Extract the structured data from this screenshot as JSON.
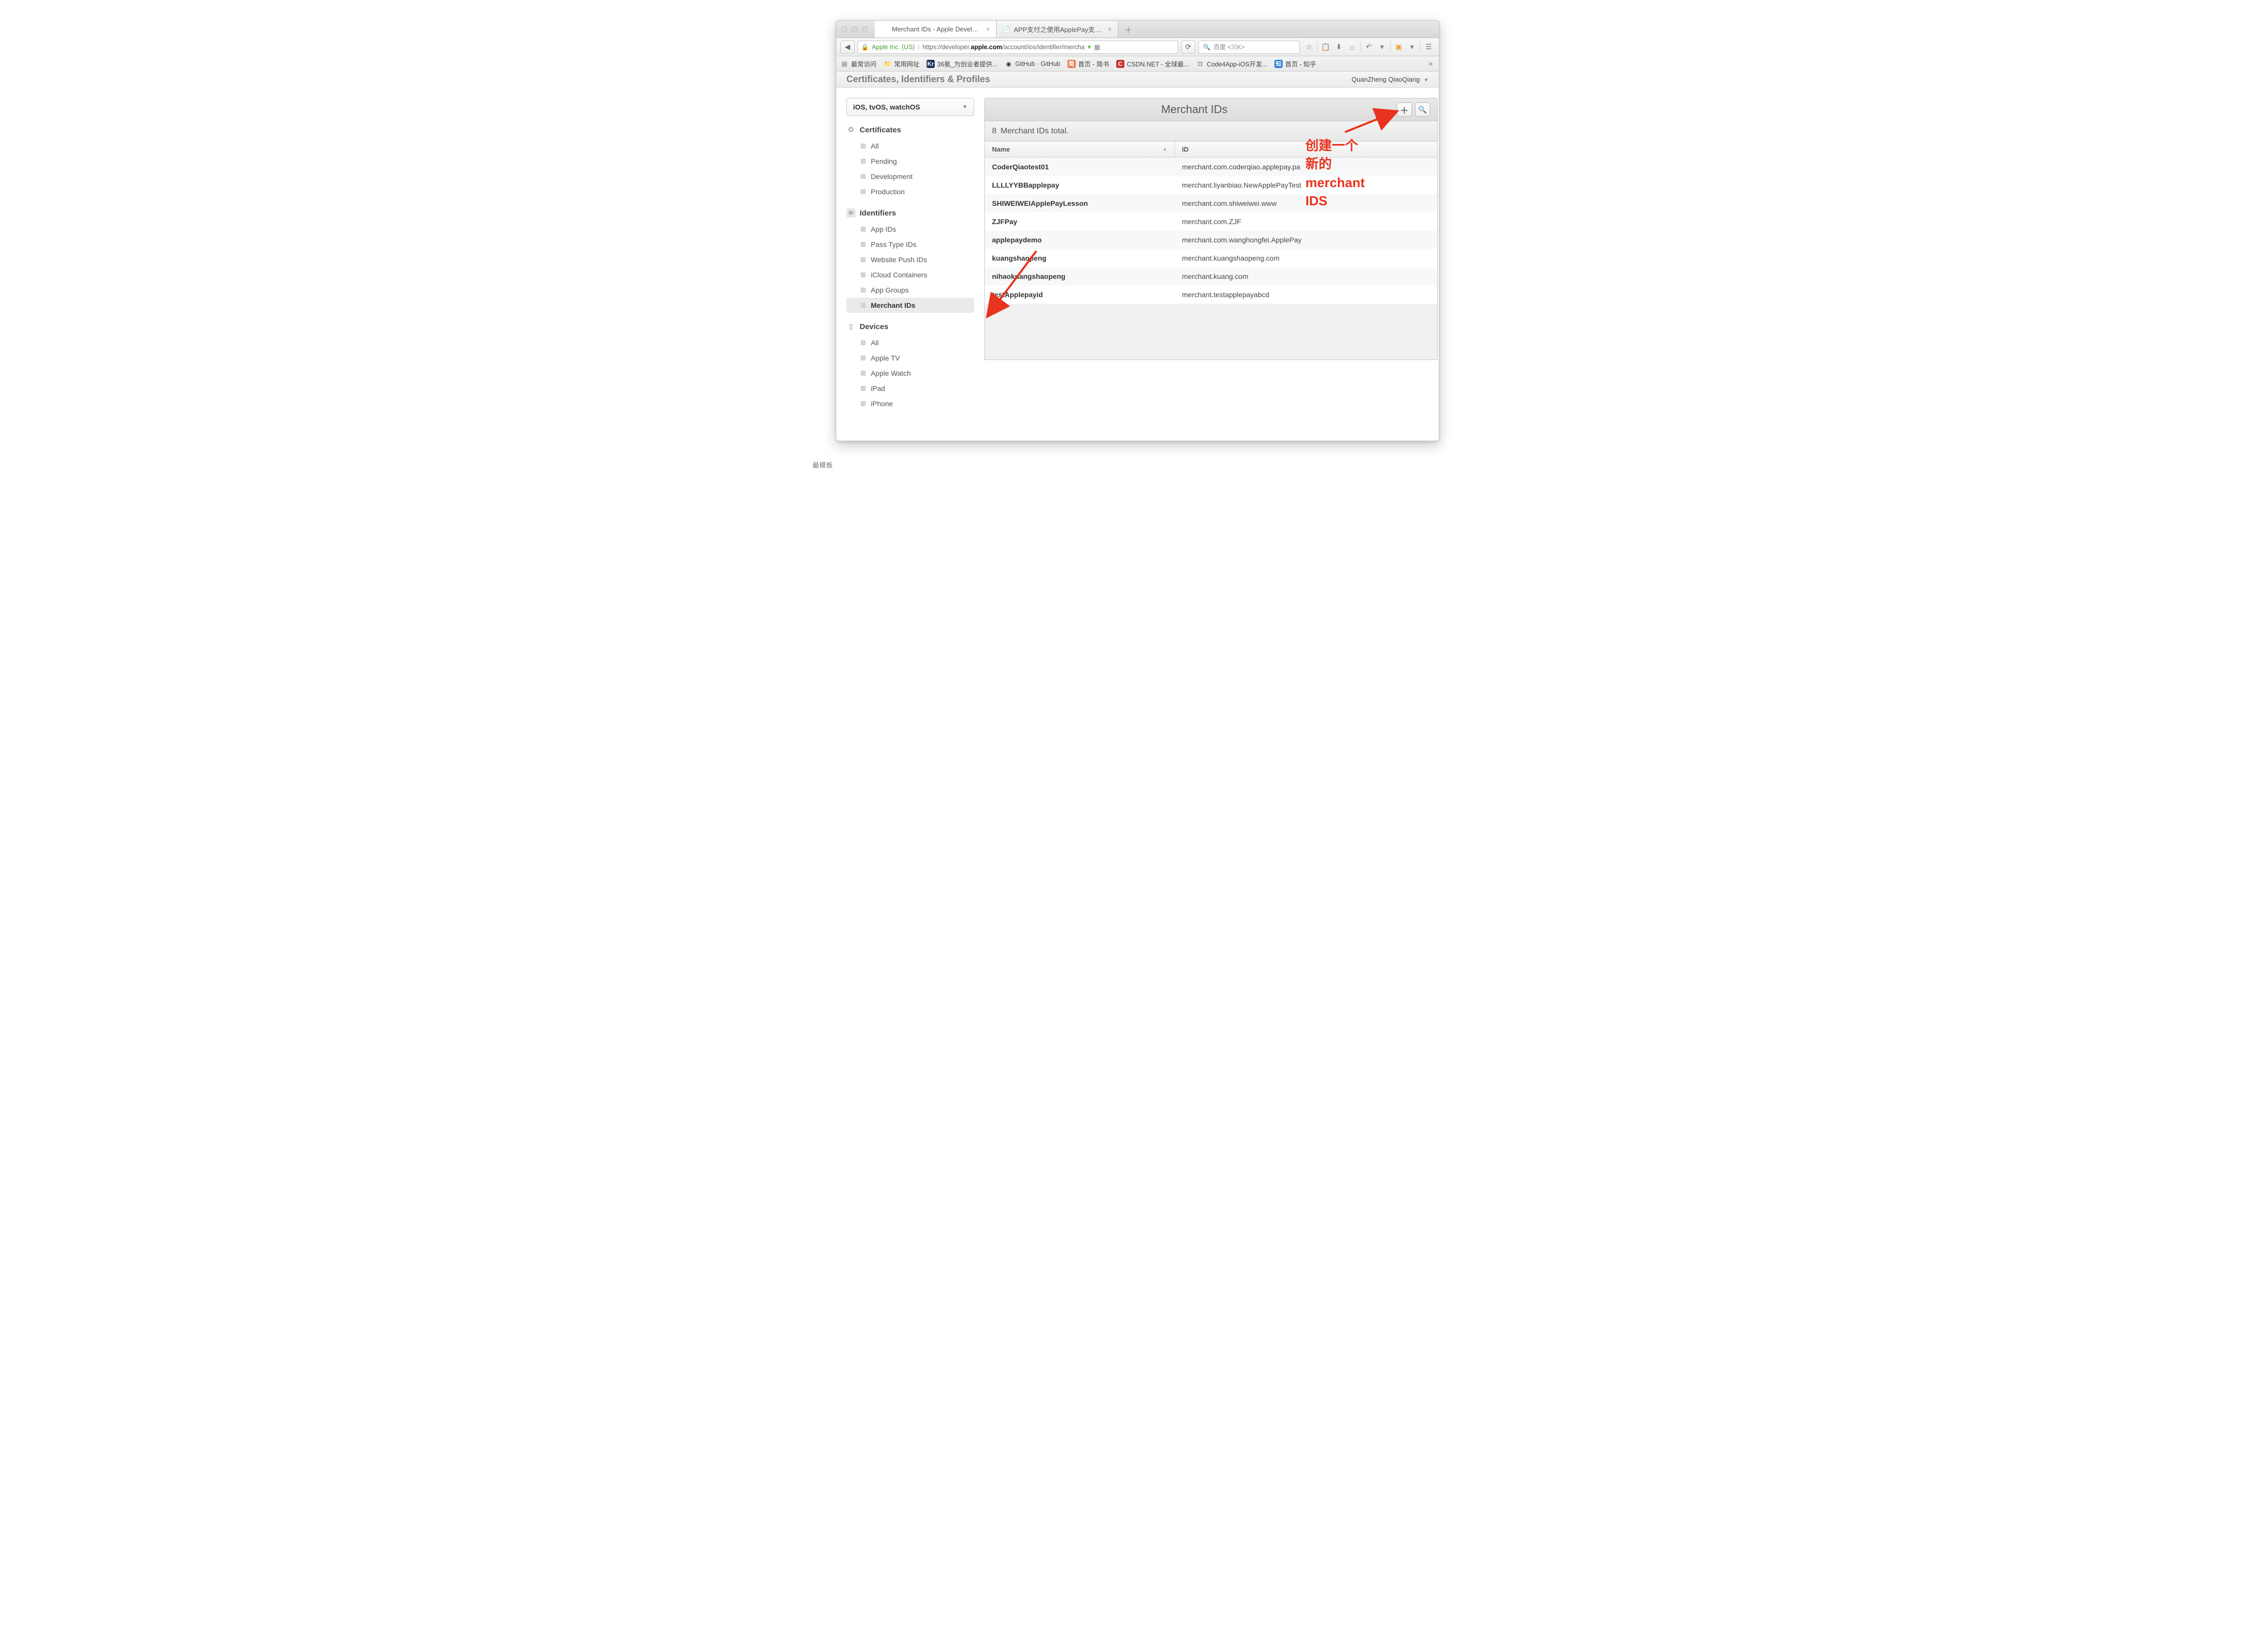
{
  "browser": {
    "tabs": [
      {
        "label": "Merchant IDs - Apple Developer",
        "active": true
      },
      {
        "label": "APP支付之使用ApplePay支付开发...",
        "active": false
      }
    ],
    "org": "Apple Inc. (US)",
    "url_prefix": "https://developer.",
    "url_host": "apple.com",
    "url_path": "/account/ios/identifier/mercha",
    "search_placeholder": "百度 <⌘K>",
    "bookmarks": [
      {
        "label": "最常访问",
        "iconClass": "bi-g"
      },
      {
        "label": "常用网址",
        "iconClass": "bi-g"
      },
      {
        "label": "36氪_为创业者提供...",
        "iconClass": "bi-k",
        "iconText": "Kr"
      },
      {
        "label": "GitHub · GitHub",
        "iconClass": "bi-gh",
        "iconText": "◉"
      },
      {
        "label": "首页 - 简书",
        "iconClass": "bi-or",
        "iconText": "简"
      },
      {
        "label": "CSDN.NET - 全球最...",
        "iconClass": "bi-rd",
        "iconText": "C"
      },
      {
        "label": "Code4App-iOS开发...",
        "iconClass": "bi-g",
        "iconText": "⊡"
      },
      {
        "label": "首页 - 知乎",
        "iconClass": "bi-bl",
        "iconText": "知"
      }
    ]
  },
  "page": {
    "breadcrumb": "Certificates, Identifiers & Profiles",
    "user": "QuanZheng QiaoQiang",
    "platform": "iOS, tvOS, watchOS",
    "panel_title": "Merchant IDs",
    "summary_count": "8",
    "summary_text": "Merchant IDs total.",
    "columns": {
      "name": "Name",
      "id": "ID"
    },
    "rows": [
      {
        "name": "CoderQiaotest01",
        "id": "merchant.com.coderqiao.applepay.pa"
      },
      {
        "name": "LLLLYYBBapplepay",
        "id": "merchant.liyanbiao.NewApplePayTest"
      },
      {
        "name": "SHIWEIWEIApplePayLesson",
        "id": "merchant.com.shiweiwei.www"
      },
      {
        "name": "ZJFPay",
        "id": "merchant.com.ZJF"
      },
      {
        "name": "applepaydemo",
        "id": "merchant.com.wanghongfei.ApplePay"
      },
      {
        "name": "kuangshaopeng",
        "id": "merchant.kuangshaopeng.com"
      },
      {
        "name": "nihaokuangshaopeng",
        "id": "merchant.kuang.com"
      },
      {
        "name": "testApplepayid",
        "id": "merchant.testapplepayabcd"
      }
    ],
    "nav": {
      "certificates": {
        "title": "Certificates",
        "items": [
          "All",
          "Pending",
          "Development",
          "Production"
        ]
      },
      "identifiers": {
        "title": "Identifiers",
        "items": [
          "App IDs",
          "Pass Type IDs",
          "Website Push IDs",
          "iCloud Containers",
          "App Groups",
          "Merchant IDs"
        ],
        "selected": "Merchant IDs"
      },
      "devices": {
        "title": "Devices",
        "items": [
          "All",
          "Apple TV",
          "Apple Watch",
          "iPad",
          "iPhone"
        ]
      }
    }
  },
  "annotations": {
    "line1": "创建一个",
    "line2": "新的",
    "line3": "merchant",
    "line4": "IDS"
  },
  "footer_brand": "最模板"
}
